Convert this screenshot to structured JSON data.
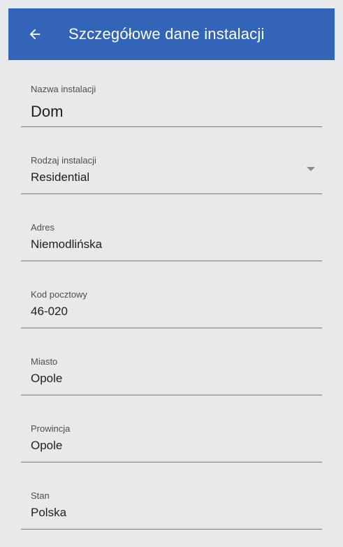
{
  "header": {
    "title": "Szczegółowe dane instalacji",
    "back_icon": "arrow-left-icon",
    "background": "#3264b7"
  },
  "form": {
    "fields": [
      {
        "label": "Nazwa instalacji",
        "value": "Dom"
      },
      {
        "label": "Rodzaj instalacji",
        "value": "Residential",
        "icon": "dropdown-arrow-icon"
      },
      {
        "label": "Adres",
        "value": "Niemodlińska"
      },
      {
        "label": "Kod pocztowy",
        "value": "46-020"
      },
      {
        "label": "Miasto",
        "value": "Opole"
      },
      {
        "label": "Prowincja",
        "value": "Opole"
      },
      {
        "label": "Stan",
        "value": "Polska"
      }
    ]
  }
}
